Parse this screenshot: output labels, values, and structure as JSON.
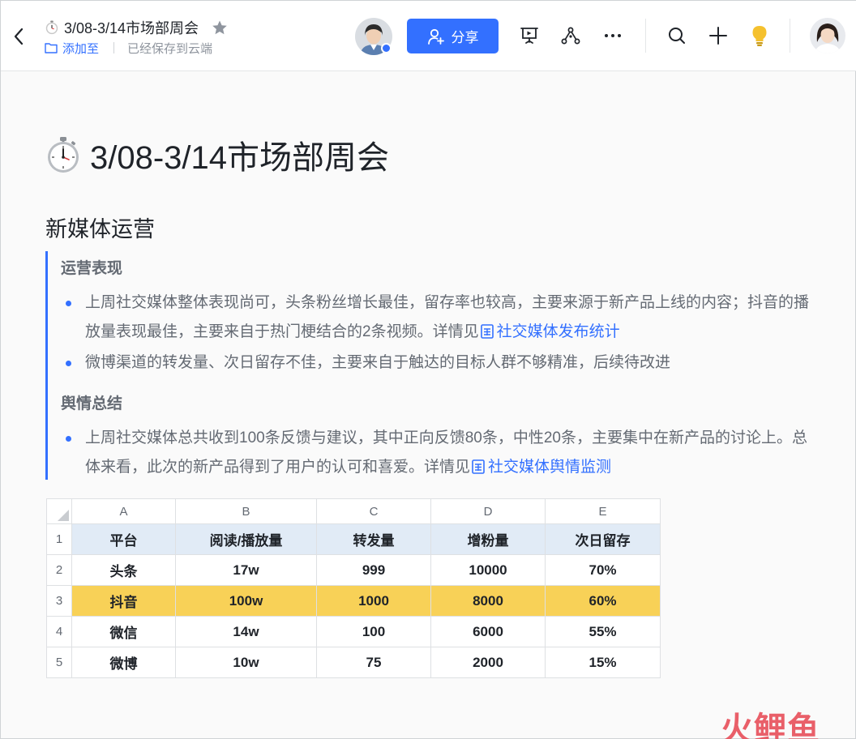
{
  "header": {
    "back_label": "",
    "doc_title": "3/08-3/14市场部周会",
    "add_to_label": "添加至",
    "saved_status": "已经保存到云端",
    "share_label": "分享",
    "icons": [
      "back-icon",
      "stopwatch-icon",
      "star-icon",
      "folder-icon",
      "add-user-icon",
      "present-icon",
      "share-graph-icon",
      "more-icon",
      "search-icon",
      "plus-icon",
      "lightbulb-icon"
    ]
  },
  "doc": {
    "title": "3/08-3/14市场部周会",
    "section_title": "新媒体运营",
    "subsections": [
      {
        "heading": "运营表现",
        "items": [
          {
            "text": "上周社交媒体整体表现尚可，头条粉丝增长最佳，留存率也较高，主要来源于新产品上线的内容；抖音的播放量表现最佳，主要来自于热门梗结合的2条视频。详情见",
            "link": "社交媒体发布统计"
          },
          {
            "text": "微博渠道的转发量、次日留存不佳，主要来自于触达的目标人群不够精准，后续待改进",
            "link": ""
          }
        ]
      },
      {
        "heading": "舆情总结",
        "items": [
          {
            "text": "上周社交媒体总共收到100条反馈与建议，其中正向反馈80条，中性20条，主要集中在新产品的讨论上。总体来看，此次的新产品得到了用户的认可和喜爱。详情见",
            "link": "社交媒体舆情监测"
          }
        ]
      }
    ]
  },
  "sheet": {
    "col_letters": [
      "A",
      "B",
      "C",
      "D",
      "E"
    ],
    "row_numbers": [
      "1",
      "2",
      "3",
      "4",
      "5"
    ],
    "rows": [
      [
        "平台",
        "阅读/播放量",
        "转发量",
        "增粉量",
        "次日留存"
      ],
      [
        "头条",
        "17w",
        "999",
        "10000",
        "70%"
      ],
      [
        "抖音",
        "100w",
        "1000",
        "8000",
        "60%"
      ],
      [
        "微信",
        "14w",
        "100",
        "6000",
        "55%"
      ],
      [
        "微博",
        "10w",
        "75",
        "2000",
        "15%"
      ]
    ],
    "highlight_color": "#f8d157",
    "header_color": "#e1ebf6"
  },
  "colors": {
    "accent": "#3370ff",
    "text": "#1f2329",
    "muted": "#646a73"
  },
  "watermark": "火鲤鱼"
}
